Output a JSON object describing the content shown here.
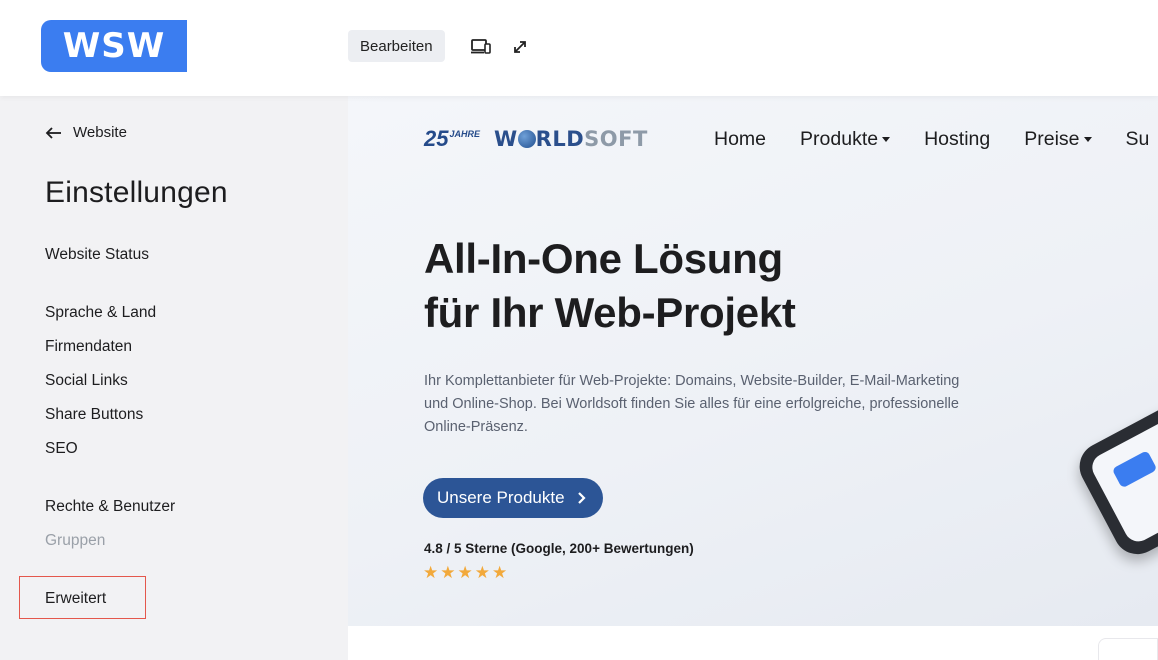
{
  "topbar": {
    "logo_text": "WSW",
    "edit_label": "Bearbeiten",
    "icons": [
      "devices-icon",
      "expand-icon"
    ]
  },
  "sidebar": {
    "back_label": "Website",
    "title": "Einstellungen",
    "items": [
      {
        "label": "Website Status"
      },
      {
        "label": "Sprache & Land"
      },
      {
        "label": "Firmendaten"
      },
      {
        "label": "Social Links"
      },
      {
        "label": "Share Buttons"
      },
      {
        "label": "SEO"
      },
      {
        "label": "Rechte & Benutzer"
      },
      {
        "label": "Gruppen",
        "disabled": true
      },
      {
        "label": "Erweitert",
        "highlighted": true
      }
    ]
  },
  "preview": {
    "brand": {
      "badge_num": "25",
      "badge_text": "JAHRE",
      "name_part1": "W",
      "name_part2": "RLD",
      "name_part3": "SOFT"
    },
    "nav": [
      "Home",
      "Produkte",
      "Hosting",
      "Preise",
      "Su"
    ],
    "hero_line1": "All-In-One Lösung",
    "hero_line2": "für Ihr Web-Projekt",
    "description": "Ihr Komplettanbieter für Web-Projekte: Domains, Website-Builder, E-Mail-Marketing und Online-Shop. Bei Worldsoft finden Sie alles für eine erfolgreiche, professionelle Online-Präsenz.",
    "cta_label": "Unsere Produkte",
    "rating_text": "4.8 / 5 Sterne (Google, 200+ Bewertungen)",
    "stars": 5
  },
  "colors": {
    "logo_bg": "#3b7df0",
    "cta_bg": "#2c5596",
    "star": "#f2a93b",
    "highlight": "#e4574c"
  }
}
